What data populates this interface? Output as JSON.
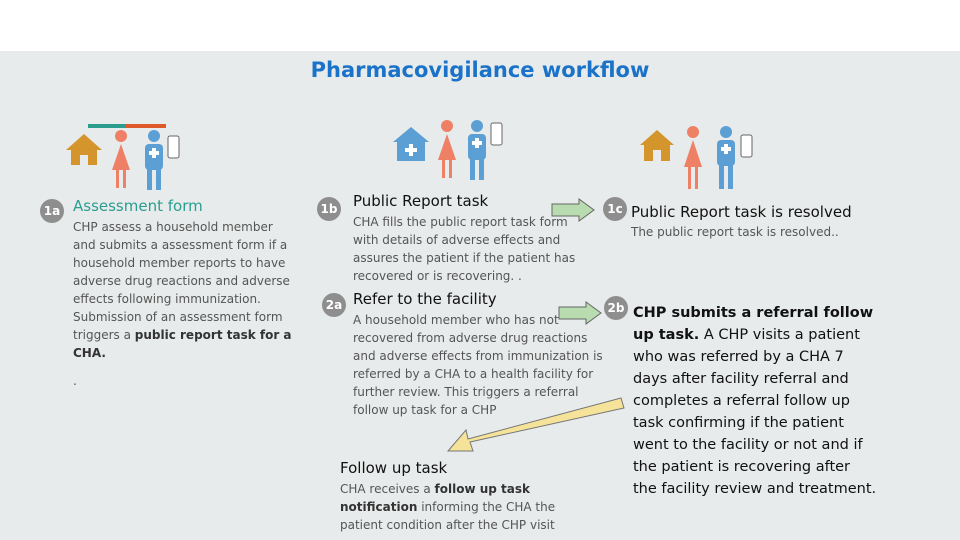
{
  "title": "Pharmacovigilance workflow",
  "steps": {
    "s1a": {
      "badge": "1a",
      "heading": "Assessment form",
      "body": "CHP assess a household member and submits a assessment form if a household member reports to have adverse drug reactions and adverse effects following immunization. Submission of an assessment form triggers a ",
      "body_bold": "public report task for a CHA.",
      "trailer": "."
    },
    "s1b": {
      "badge": "1b",
      "heading": "Public Report task",
      "body": "CHA fills the public report task form with details of adverse effects and assures the patient if the patient has recovered or is recovering. ."
    },
    "s1c": {
      "badge": "1c",
      "heading": "Public Report task is resolved",
      "body": "The public report task is resolved.."
    },
    "s2a": {
      "badge": "2a",
      "heading": "Refer to the facility",
      "body": "A household member who has not recovered from adverse drug reactions and adverse effects from immunization is referred by a CHA to a health facility for further review. This triggers a referral follow up task for a CHP"
    },
    "s2b": {
      "badge": "2b",
      "heading_bold": "CHP submits a referral follow up task.",
      "body": " A CHP visits a patient who was referred by a CHA 7 days after facility referral and completes a referral follow up task confirming if the patient went to the facility or not and if the patient is recovering after the facility review and treatment."
    },
    "followup": {
      "heading": "Follow up task",
      "body_pre": "CHA receives a ",
      "body_bold": "follow up task notification",
      "body_post": " informing the CHA the patient condition after the CHP visit"
    }
  },
  "colors": {
    "title": "#1a73c8",
    "teal": "#2a9d8f",
    "house": "#d4952d",
    "woman": "#ee8066",
    "health_worker": "#5b9fd4",
    "arrow_green": "#b8dbb0",
    "arrow_yellow": "#f5e39a"
  },
  "icons": [
    "house-icon",
    "woman-icon",
    "health-worker-icon",
    "phone-icon",
    "health-facility-icon"
  ]
}
